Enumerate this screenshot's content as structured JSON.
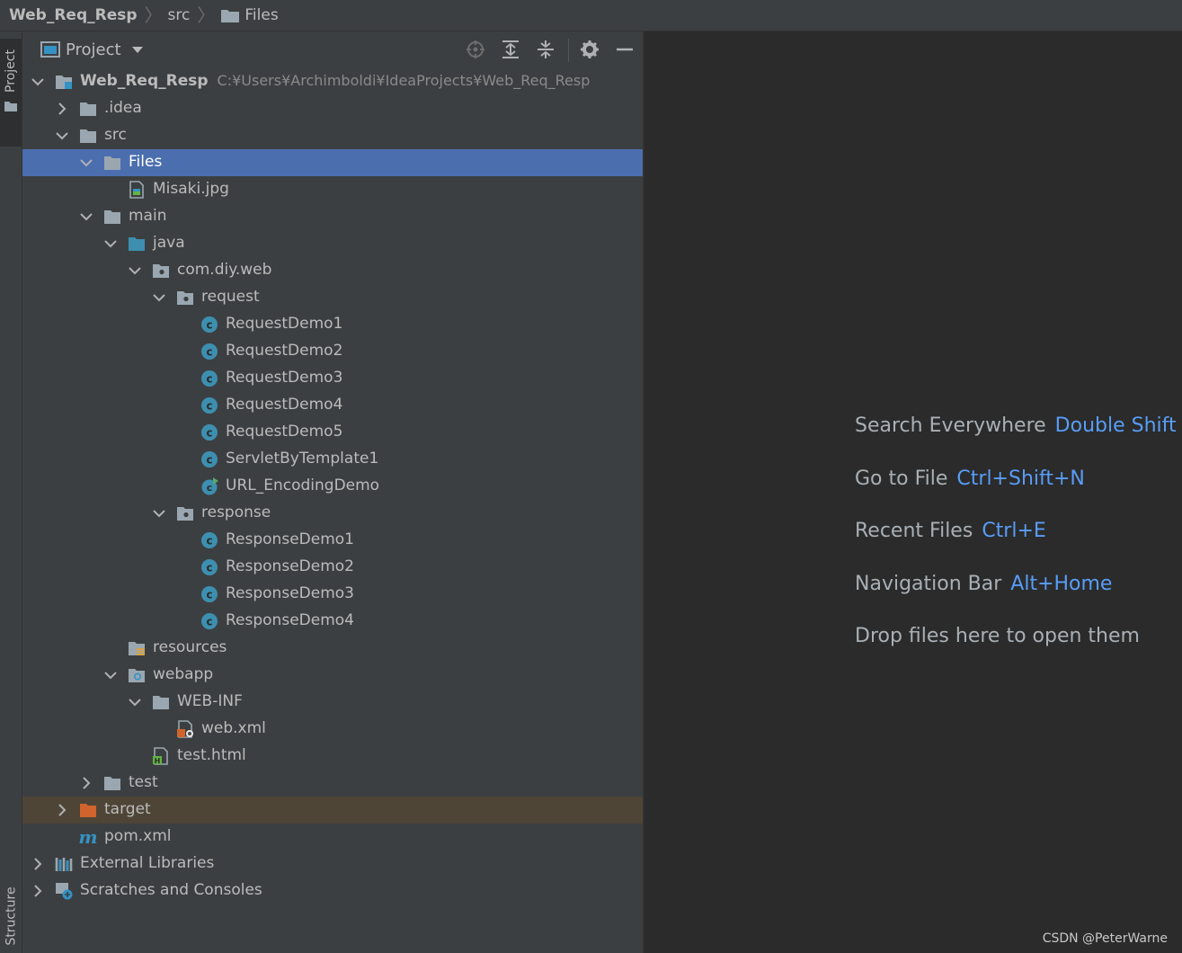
{
  "breadcrumb": [
    {
      "label": "Web_Req_Resp",
      "icon": "none"
    },
    {
      "label": "src",
      "icon": "none"
    },
    {
      "label": "Files",
      "icon": "folder-icon"
    }
  ],
  "left_stripe": {
    "project_tab": "Project",
    "structure_tab": "Structure"
  },
  "panel": {
    "title": "Project"
  },
  "tree": [
    {
      "label": "Web_Req_Resp",
      "path": "C:¥Users¥Archimboldi¥IdeaProjects¥Web_Req_Resp",
      "icon": "module-folder-icon",
      "arrow": "down",
      "level": 0
    },
    {
      "label": ".idea",
      "icon": "folder-icon",
      "arrow": "right",
      "level": 1
    },
    {
      "label": "src",
      "icon": "folder-icon",
      "arrow": "down",
      "level": 1
    },
    {
      "label": "Files",
      "icon": "folder-icon",
      "arrow": "down",
      "level": 2,
      "state": "selected"
    },
    {
      "label": "Misaki.jpg",
      "icon": "image-file-icon",
      "arrow": "none",
      "level": 3
    },
    {
      "label": "main",
      "icon": "folder-icon",
      "arrow": "down",
      "level": 2
    },
    {
      "label": "java",
      "icon": "source-folder-icon",
      "arrow": "down",
      "level": 3
    },
    {
      "label": "com.diy.web",
      "icon": "package-icon",
      "arrow": "down",
      "level": 4
    },
    {
      "label": "request",
      "icon": "package-icon",
      "arrow": "down",
      "level": 5
    },
    {
      "label": "RequestDemo1",
      "icon": "class-icon",
      "arrow": "none",
      "level": 6
    },
    {
      "label": "RequestDemo2",
      "icon": "class-icon",
      "arrow": "none",
      "level": 6
    },
    {
      "label": "RequestDemo3",
      "icon": "class-icon",
      "arrow": "none",
      "level": 6
    },
    {
      "label": "RequestDemo4",
      "icon": "class-icon",
      "arrow": "none",
      "level": 6
    },
    {
      "label": "RequestDemo5",
      "icon": "class-icon",
      "arrow": "none",
      "level": 6
    },
    {
      "label": "ServletByTemplate1",
      "icon": "class-icon",
      "arrow": "none",
      "level": 6
    },
    {
      "label": "URL_EncodingDemo",
      "icon": "runnable-class-icon",
      "arrow": "none",
      "level": 6
    },
    {
      "label": "response",
      "icon": "package-icon",
      "arrow": "down",
      "level": 5
    },
    {
      "label": "ResponseDemo1",
      "icon": "class-icon",
      "arrow": "none",
      "level": 6
    },
    {
      "label": "ResponseDemo2",
      "icon": "class-icon",
      "arrow": "none",
      "level": 6
    },
    {
      "label": "ResponseDemo3",
      "icon": "class-icon",
      "arrow": "none",
      "level": 6
    },
    {
      "label": "ResponseDemo4",
      "icon": "class-icon",
      "arrow": "none",
      "level": 6
    },
    {
      "label": "resources",
      "icon": "resources-folder-icon",
      "arrow": "none",
      "level": 3
    },
    {
      "label": "webapp",
      "icon": "web-folder-icon",
      "arrow": "down",
      "level": 3
    },
    {
      "label": "WEB-INF",
      "icon": "folder-icon",
      "arrow": "down",
      "level": 4
    },
    {
      "label": "web.xml",
      "icon": "xml-file-icon",
      "arrow": "none",
      "level": 5
    },
    {
      "label": "test.html",
      "icon": "html-file-icon",
      "arrow": "none",
      "level": 4
    },
    {
      "label": "test",
      "icon": "folder-icon",
      "arrow": "right",
      "level": 2
    },
    {
      "label": "target",
      "icon": "excluded-folder-icon",
      "arrow": "right",
      "level": 1,
      "state": "excluded"
    },
    {
      "label": "pom.xml",
      "icon": "maven-icon",
      "arrow": "none",
      "level": 1
    },
    {
      "label": "External Libraries",
      "icon": "libraries-icon",
      "arrow": "right",
      "level": 0
    },
    {
      "label": "Scratches and Consoles",
      "icon": "scratches-icon",
      "arrow": "right",
      "level": 0
    }
  ],
  "editor_hints": [
    {
      "text": "Search Everywhere",
      "key": "Double Shift"
    },
    {
      "text": "Go to File",
      "key": "Ctrl+Shift+N"
    },
    {
      "text": "Recent Files",
      "key": "Ctrl+E"
    },
    {
      "text": "Navigation Bar",
      "key": "Alt+Home"
    },
    {
      "text": "Drop files here to open them",
      "key": ""
    }
  ],
  "watermark": "CSDN @PeterWarne",
  "colors": {
    "selection": "#4b6eaf",
    "excluded_row": "#4e4536",
    "shortcut": "#589df6",
    "class_icon": "#3d8fb0"
  }
}
